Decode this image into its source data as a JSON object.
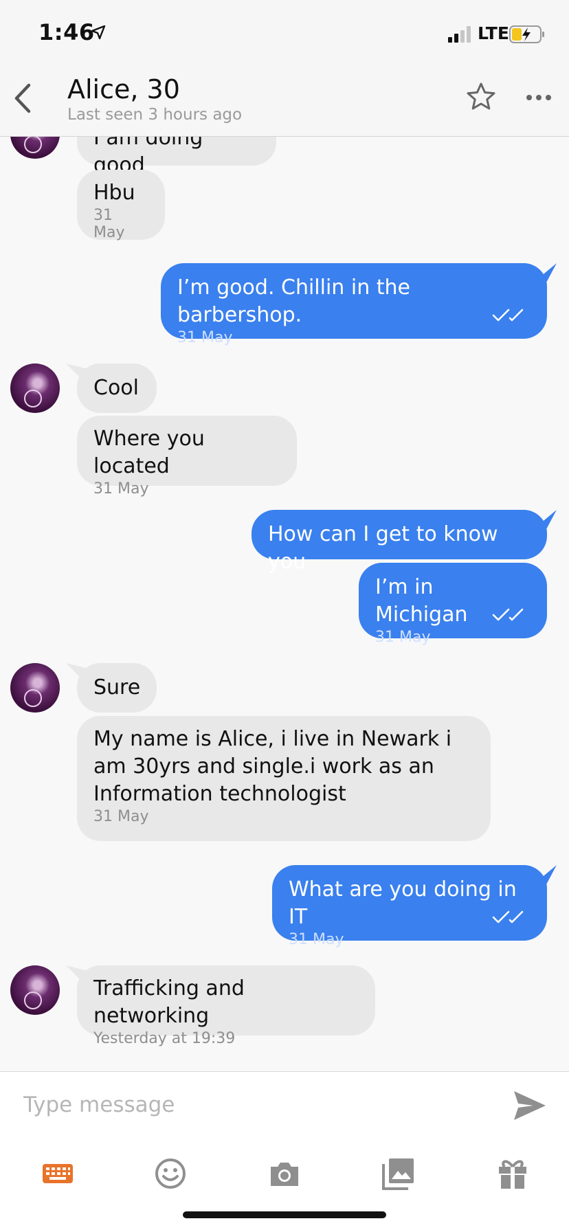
{
  "status_bar": {
    "time": "1:46",
    "network": "LTE"
  },
  "header": {
    "title": "Alice, 30",
    "subtitle": "Last seen 3 hours ago"
  },
  "messages": [
    {
      "from": "them",
      "text": "I am doing good"
    },
    {
      "from": "them",
      "text": "Hbu",
      "time": "31 May"
    },
    {
      "from": "me",
      "text": "I’m good. Chillin in the barbershop.",
      "time": "31 May"
    },
    {
      "from": "them",
      "text": "Cool"
    },
    {
      "from": "them",
      "text": "Where you located",
      "time": "31 May"
    },
    {
      "from": "me",
      "text": "How can I get to know you"
    },
    {
      "from": "me",
      "text": "I’m in Michigan",
      "time": "31 May"
    },
    {
      "from": "them",
      "text": "Sure"
    },
    {
      "from": "them",
      "text": "My name is Alice, i live in Newark i am 30yrs and single.i work as an Information technologist",
      "time": "31 May"
    },
    {
      "from": "me",
      "text": "What are you doing in IT",
      "time": "31 May"
    },
    {
      "from": "them",
      "text": "Trafficking and networking",
      "time": "Yesterday at 19:39"
    }
  ],
  "composer": {
    "placeholder": "Type message"
  },
  "colors": {
    "outgoing_bubble": "#3a80ee",
    "incoming_bubble": "#e8e8e8",
    "keyboard_icon": "#e8732a"
  },
  "icons": [
    "back-chevron-icon",
    "star-icon",
    "more-icon",
    "send-icon",
    "keyboard-icon",
    "emoji-icon",
    "camera-icon",
    "gallery-icon",
    "gift-icon"
  ]
}
